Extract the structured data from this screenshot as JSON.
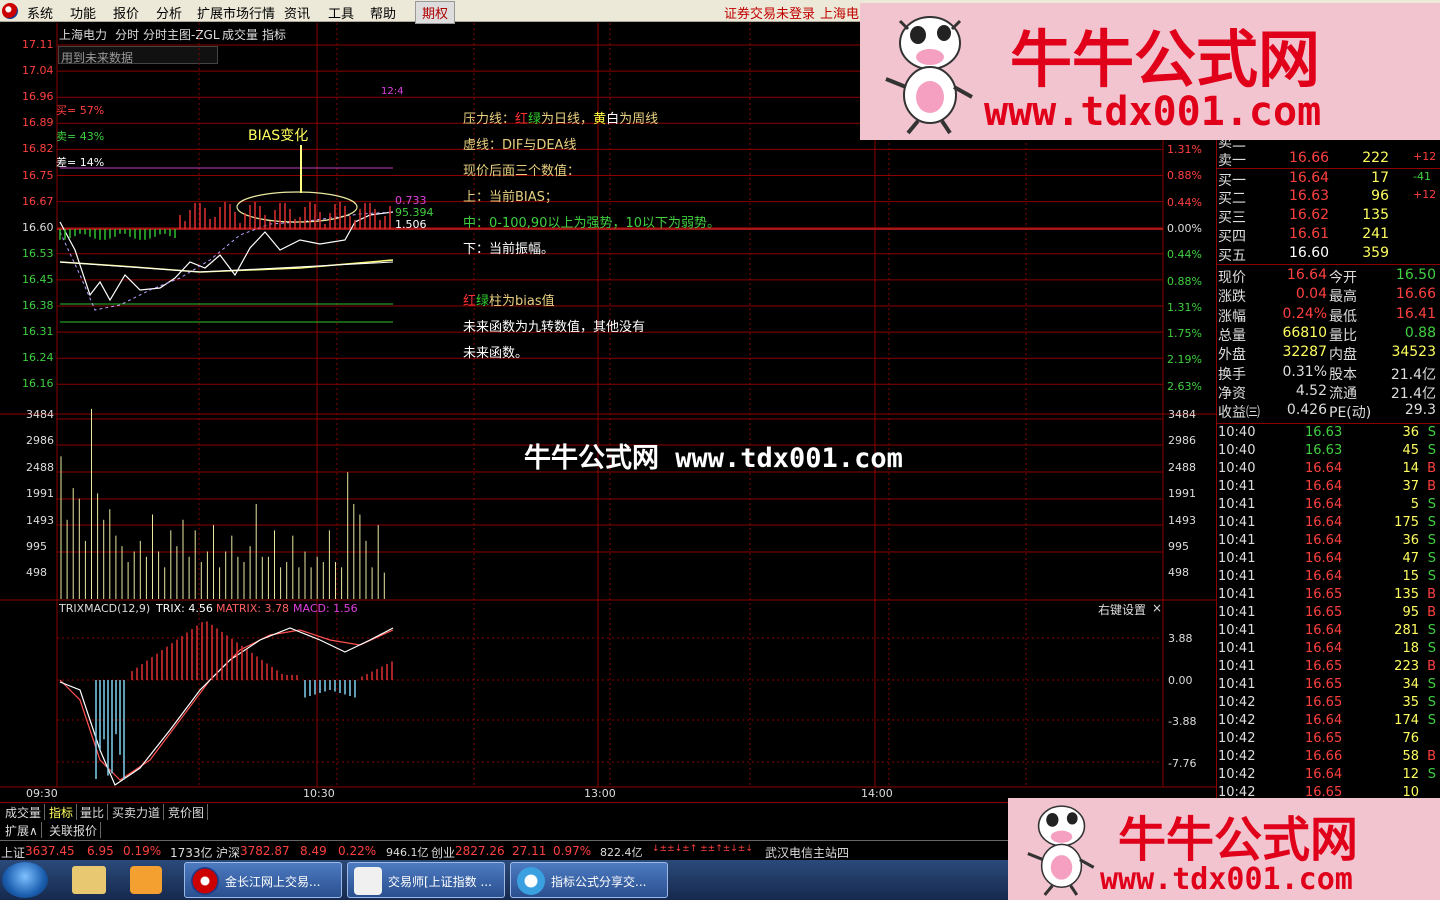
{
  "menu": {
    "items": [
      "系统",
      "功能",
      "报价",
      "分析",
      "扩展市场行情",
      "资讯",
      "工具",
      "帮助"
    ],
    "active": "期权",
    "login_status": "证券交易未登录",
    "stock": "上海电力"
  },
  "chart_header": {
    "stock": "上海电力",
    "period": "分时",
    "main_label": "分时主图-ZGL",
    "vol_label": "成交量",
    "indicator_label": "指标",
    "future_note": "用到未来数据"
  },
  "stats": {
    "buy": "买= 57%",
    "sell": "卖= 43%",
    "diff": "差= 14%"
  },
  "annotation": {
    "bias_change": "BIAS变化",
    "marker": "12:4",
    "val1": "0.733",
    "val2": "95.394",
    "val3": "1.506",
    "lines": [
      [
        {
          "t": "压力线：",
          "c": "#e8d080"
        },
        {
          "t": "红",
          "c": "#ff3030"
        },
        {
          "t": "绿",
          "c": "#30d030"
        },
        {
          "t": "为日线，",
          "c": "#e8d080"
        },
        {
          "t": "黄",
          "c": "#ffff40"
        },
        {
          "t": "白",
          "c": "#ffffff"
        },
        {
          "t": "为周线",
          "c": "#e8d080"
        }
      ],
      [
        {
          "t": "虚线：DIF与DEA线",
          "c": "#e8d080"
        }
      ],
      [
        {
          "t": "现价后面三个数值：",
          "c": "#e8d080"
        }
      ],
      [
        {
          "t": "上：当前BIAS；",
          "c": "#e8d080"
        }
      ],
      [
        {
          "t": "中：0-100,90以上为强势，10以下为弱势。",
          "c": "#40d040"
        }
      ],
      [
        {
          "t": "下：当前振幅。",
          "c": "#ffffff"
        }
      ],
      [
        {
          "t": "",
          "c": "#fff"
        }
      ],
      [
        {
          "t": "红",
          "c": "#ff3030"
        },
        {
          "t": "绿",
          "c": "#30d030"
        },
        {
          "t": "柱为bias值",
          "c": "#e8d080"
        }
      ],
      [
        {
          "t": "未来函数为九转数值，其他没有",
          "c": "#ffffff"
        }
      ],
      [
        {
          "t": "未来函数。",
          "c": "#ffffff"
        }
      ]
    ]
  },
  "price_axis": {
    "left": [
      "17.11",
      "17.04",
      "16.96",
      "16.89",
      "16.82",
      "16.75",
      "16.67",
      "16.60",
      "16.53",
      "16.45",
      "16.38",
      "16.31",
      "16.24",
      "16.16"
    ],
    "right": [
      "1.31%",
      "0.88%",
      "0.44%",
      "0.00%",
      "0.44%",
      "0.88%",
      "1.31%",
      "1.75%",
      "2.19%",
      "2.63%"
    ]
  },
  "vol_axis": [
    "3484",
    "2986",
    "2488",
    "1991",
    "1493",
    "995",
    "498"
  ],
  "macd": {
    "title": "TRIXMACD(12,9)",
    "trix": "TRIX: 4.56",
    "matrix": "MATRIX: 3.78",
    "macd": "MACD: 1.56",
    "settings": "右键设置",
    "close": "×",
    "axis": [
      "3.88",
      "0.00",
      "-3.88",
      "-7.76"
    ]
  },
  "time_axis": [
    "09:30",
    "10:30",
    "13:00",
    "14:00"
  ],
  "center_watermark": "牛牛公式网 www.tdx001.com",
  "watermark": {
    "title": "牛牛公式网",
    "url": "www.tdx001.com"
  },
  "order_book": [
    {
      "label": "卖二",
      "price": "",
      "vol": "",
      "chg": ""
    },
    {
      "label": "卖一",
      "price": "16.66",
      "vol": "222",
      "chg": "+12"
    },
    {
      "label": "买一",
      "price": "16.64",
      "vol": "17",
      "chg": "-41"
    },
    {
      "label": "买二",
      "price": "16.63",
      "vol": "96",
      "chg": "+12"
    },
    {
      "label": "买三",
      "price": "16.62",
      "vol": "135",
      "chg": ""
    },
    {
      "label": "买四",
      "price": "16.61",
      "vol": "241",
      "chg": ""
    },
    {
      "label": "买五",
      "price": "16.60",
      "vol": "359",
      "chg": ""
    }
  ],
  "quote": [
    {
      "l1": "现价",
      "v1": "16.64",
      "l2": "今开",
      "v2": "16.50"
    },
    {
      "l1": "涨跌",
      "v1": "0.04",
      "l2": "最高",
      "v2": "16.66"
    },
    {
      "l1": "涨幅",
      "v1": "0.24%",
      "l2": "最低",
      "v2": "16.41"
    },
    {
      "l1": "总量",
      "v1": "66810",
      "l2": "量比",
      "v2": "0.88"
    },
    {
      "l1": "外盘",
      "v1": "32287",
      "l2": "内盘",
      "v2": "34523"
    },
    {
      "l1": "换手",
      "v1": "0.31%",
      "l2": "股本",
      "v2": "21.4亿"
    },
    {
      "l1": "净资",
      "v1": "4.52",
      "l2": "流通",
      "v2": "21.4亿"
    },
    {
      "l1": "收益㈢",
      "v1": "0.426",
      "l2": "PE(动)",
      "v2": "29.3"
    }
  ],
  "ticks": [
    [
      "10:40",
      "16.63",
      "36",
      "S"
    ],
    [
      "10:40",
      "16.63",
      "45",
      "S"
    ],
    [
      "10:40",
      "16.64",
      "14",
      "B"
    ],
    [
      "10:41",
      "16.64",
      "37",
      "B"
    ],
    [
      "10:41",
      "16.64",
      "5",
      "S"
    ],
    [
      "10:41",
      "16.64",
      "175",
      "S"
    ],
    [
      "10:41",
      "16.64",
      "36",
      "S"
    ],
    [
      "10:41",
      "16.64",
      "47",
      "S"
    ],
    [
      "10:41",
      "16.64",
      "15",
      "S"
    ],
    [
      "10:41",
      "16.65",
      "135",
      "B"
    ],
    [
      "10:41",
      "16.65",
      "95",
      "B"
    ],
    [
      "10:41",
      "16.64",
      "281",
      "S"
    ],
    [
      "10:41",
      "16.64",
      "18",
      "S"
    ],
    [
      "10:41",
      "16.65",
      "223",
      "B"
    ],
    [
      "10:41",
      "16.65",
      "34",
      "S"
    ],
    [
      "10:42",
      "16.65",
      "35",
      "S"
    ],
    [
      "10:42",
      "16.64",
      "174",
      "S"
    ],
    [
      "10:42",
      "16.65",
      "76",
      ""
    ],
    [
      "10:42",
      "16.66",
      "58",
      "B"
    ],
    [
      "10:42",
      "16.64",
      "12",
      "S"
    ],
    [
      "10:42",
      "16.65",
      "10",
      ""
    ]
  ],
  "tabs": [
    "成交量",
    "指标",
    "量比",
    "买卖力道",
    "竞价图"
  ],
  "tabs2": [
    "扩展∧",
    "关联报价"
  ],
  "status": {
    "sh_label": "上证",
    "sh_val": "3637.45",
    "sh_chg": "6.95",
    "sh_pct": "0.19%",
    "sh_amt": "1733亿",
    "sz_label": "沪深",
    "sz_val": "3782.87",
    "sz_chg": "8.49",
    "sz_pct": "0.22%",
    "sz_amt": "946.1亿",
    "cy_label": "创业",
    "cy_val": "2827.26",
    "cy_chg": "27.11",
    "cy_pct": "0.97%",
    "cy_amt": "822.4亿",
    "signals": "↓±±↓±↑ ±±↑±↓±↓",
    "server": "武汉电信主站四"
  },
  "taskbar": [
    {
      "label": "金长江网上交易...",
      "icon": "app-logo-icon"
    },
    {
      "label": "交易师[上证指数 ...",
      "icon": "kt-logo-icon"
    },
    {
      "label": "指标公式分享交...",
      "icon": "ie-logo-icon"
    }
  ],
  "colors": {
    "up": "#ff3232",
    "down": "#00e600",
    "grid": "#8b0000",
    "text": "#c0c0c0",
    "accent": "#ffff00"
  }
}
